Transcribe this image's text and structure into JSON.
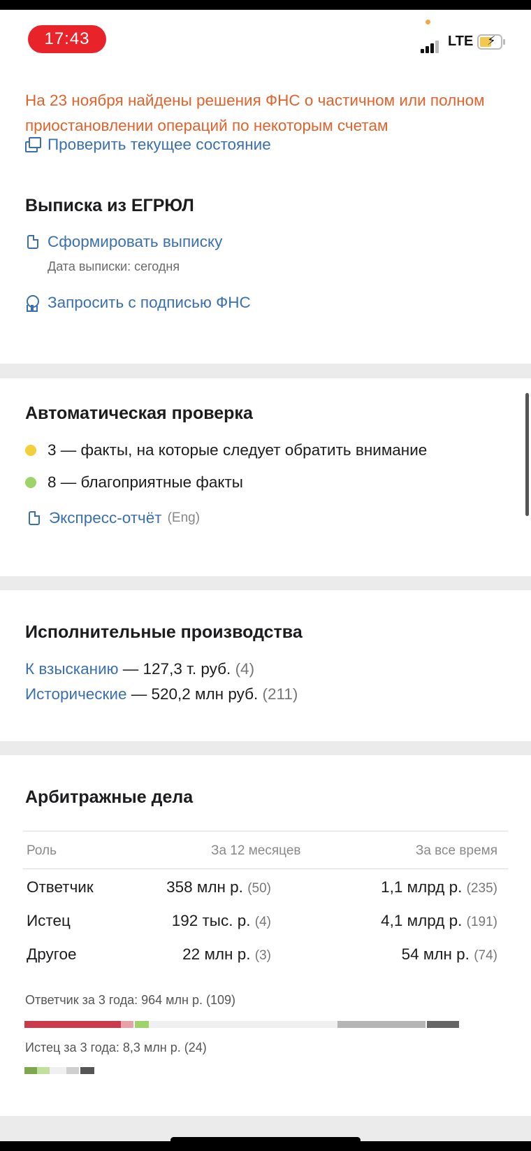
{
  "status": {
    "time": "17:43",
    "network": "LTE"
  },
  "fns": {
    "warning": "На 23 ноября найдены решения ФНС о частичном или полном приостановлении операций по некоторым счетам",
    "check_link": "Проверить текущее состояние"
  },
  "egrul": {
    "title": "Выписка из ЕГРЮЛ",
    "generate_link": "Сформировать выписку",
    "date_note": "Дата выписки: сегодня",
    "request_link": "Запросить с подписью ФНС"
  },
  "auto_check": {
    "title": "Автоматическая проверка",
    "items": [
      {
        "text": "3 — факты, на которые следует обратить внимание",
        "color": "#f4cf3c"
      },
      {
        "text": "8 — благоприятные факты",
        "color": "#9ed36a"
      }
    ],
    "report_link": "Экспресс-отчёт",
    "report_suffix": "(Eng)"
  },
  "enforcement": {
    "title": "Исполнительные производства",
    "rows": [
      {
        "label": "К взысканию",
        "value": " — 127,3 т. руб.",
        "count": " (4)"
      },
      {
        "label": "Исторические",
        "value": " — 520,2 млн руб.",
        "count": " (211)"
      }
    ]
  },
  "arbitration": {
    "title": "Арбитражные дела",
    "headers": {
      "role": "Роль",
      "year": "За 12 месяцев",
      "all": "За все время"
    },
    "rows": [
      {
        "role": "Ответчик",
        "year": "358 млн р.",
        "year_count": "(50)",
        "all": "1,1 млрд р.",
        "all_count": "(235)"
      },
      {
        "role": "Истец",
        "year": "192 тыс. р.",
        "year_count": "(4)",
        "all": "4,1 млрд р.",
        "all_count": "(191)"
      },
      {
        "role": "Другое",
        "year": "22 млн р.",
        "year_count": "(3)",
        "all": "54 млн р.",
        "all_count": "(74)"
      }
    ],
    "defendant_summary": "Ответчик за 3 года: 964 млн р. (109)",
    "plaintiff_summary": "Истец за 3 года: 8,3 млн р. (24)"
  },
  "colors": {
    "accent": "#3a6fb0",
    "warning": "#e2622b",
    "time_pill": "#e8232a"
  }
}
